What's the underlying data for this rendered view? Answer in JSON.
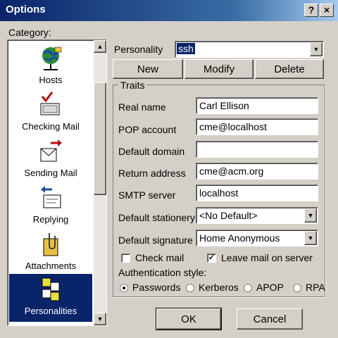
{
  "window": {
    "title": "Options",
    "help_label": "?",
    "close_label": "×"
  },
  "category": {
    "label": "Category:",
    "items": [
      {
        "label": "Hosts",
        "icon": "globe-network-icon"
      },
      {
        "label": "Checking Mail",
        "icon": "checking-mail-icon"
      },
      {
        "label": "Sending Mail",
        "icon": "sending-mail-icon"
      },
      {
        "label": "Replying",
        "icon": "replying-icon"
      },
      {
        "label": "Attachments",
        "icon": "paperclip-icon"
      },
      {
        "label": "Personalities",
        "icon": "personalities-icon"
      }
    ],
    "selected": "Personalities"
  },
  "personality": {
    "label": "Personality",
    "value": "ssh",
    "new_label": "New",
    "modify_label": "Modify",
    "delete_label": "Delete"
  },
  "traits": {
    "title": "Traits",
    "real_name_label": "Real name",
    "real_name_value": "Carl Ellison",
    "pop_account_label": "POP account",
    "pop_account_value": "cme@localhost",
    "default_domain_label": "Default domain",
    "default_domain_value": "",
    "return_address_label": "Return address",
    "return_address_value": "cme@acm.org",
    "smtp_server_label": "SMTP server",
    "smtp_server_value": "localhost",
    "default_stationery_label": "Default stationery",
    "default_stationery_value": "<No Default>",
    "default_signature_label": "Default signature",
    "default_signature_value": "Home Anonymous",
    "check_mail_label": "Check mail",
    "check_mail_checked": false,
    "leave_mail_label": "Leave mail on server",
    "leave_mail_checked": true,
    "auth_style_label": "Authentication style:",
    "auth_options": [
      "Passwords",
      "Kerberos",
      "APOP",
      "RPA"
    ],
    "auth_selected": "Passwords"
  },
  "footer": {
    "ok_label": "OK",
    "cancel_label": "Cancel"
  }
}
